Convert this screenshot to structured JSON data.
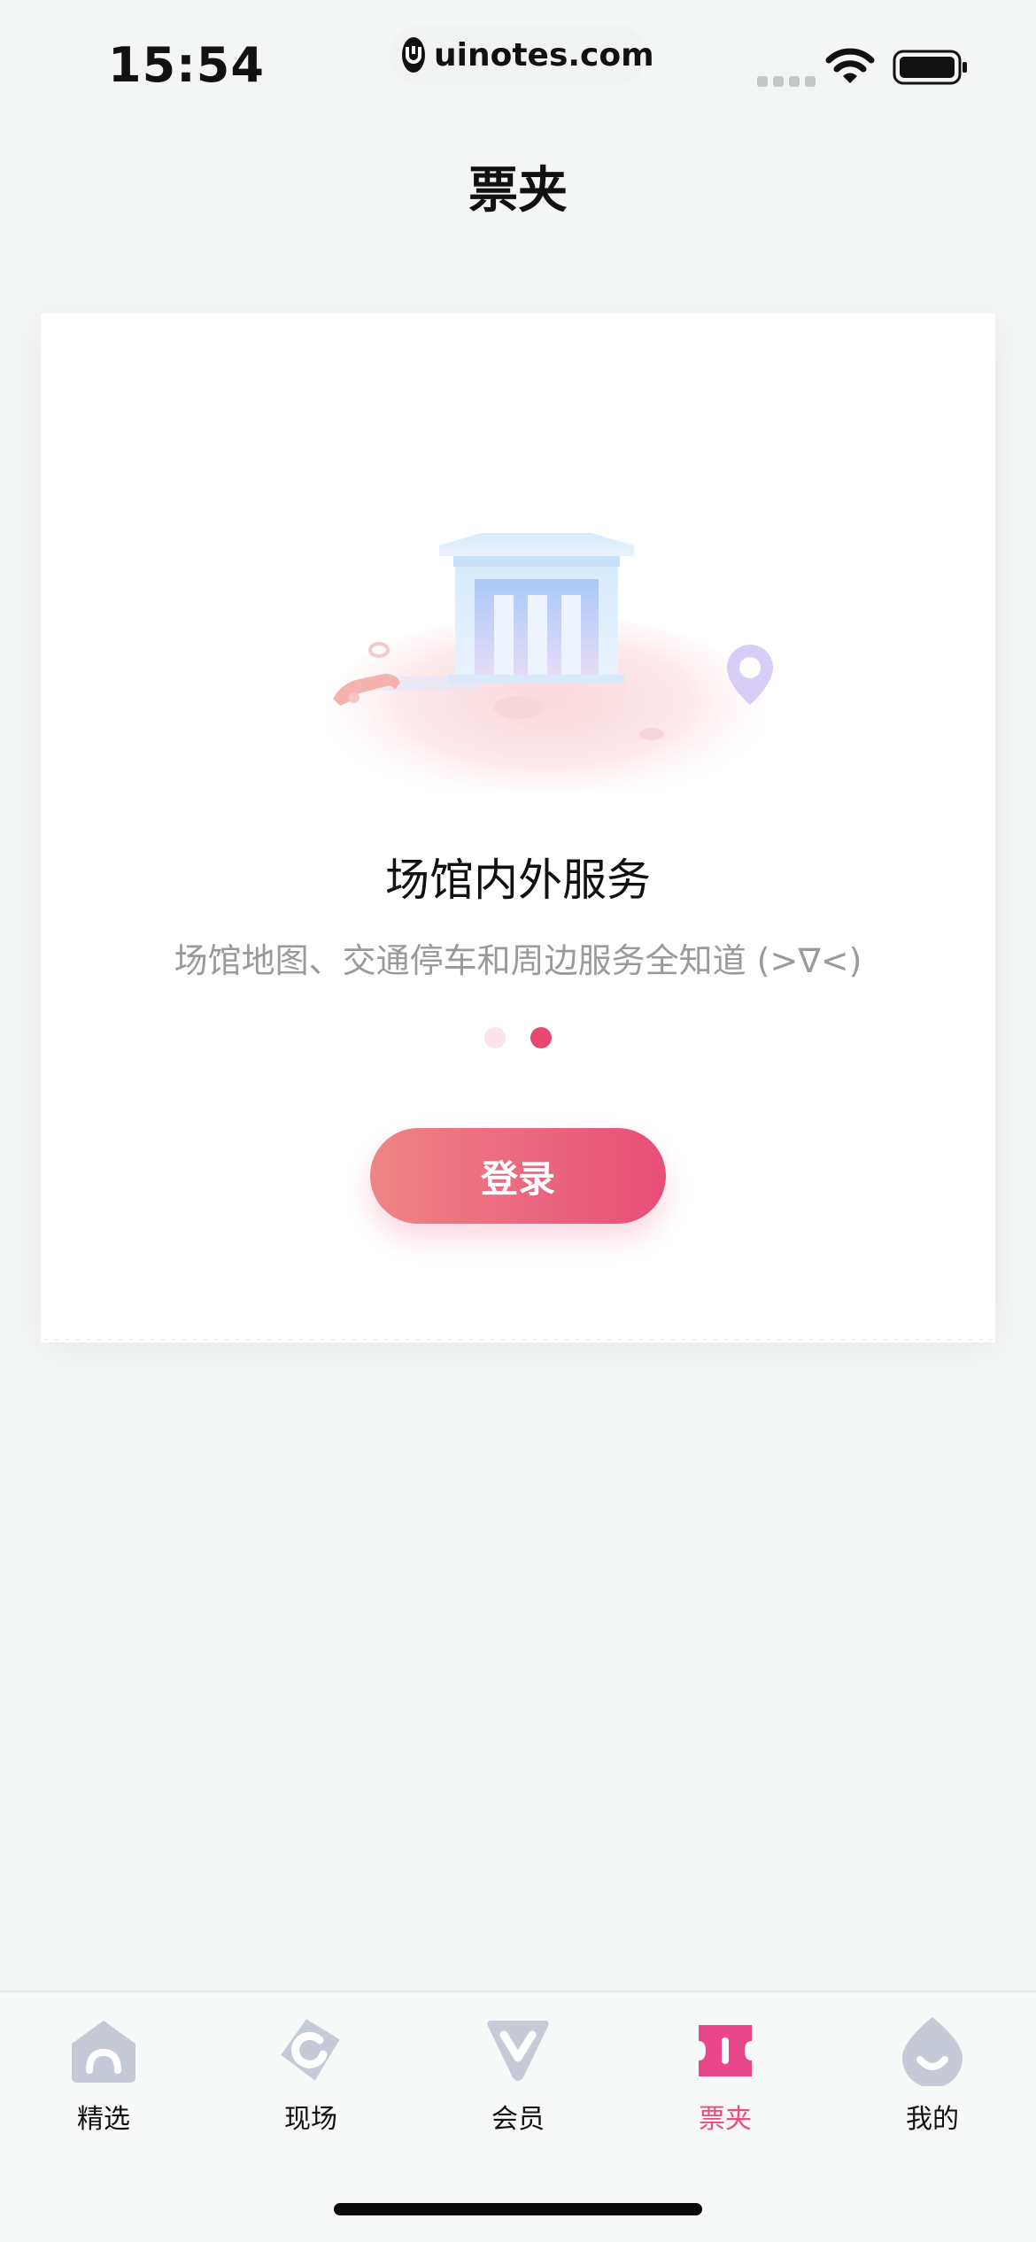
{
  "status_bar": {
    "time": "15:54",
    "url": "uinotes.com"
  },
  "nav": {
    "title": "票夹"
  },
  "card": {
    "illustration_icon": "venue-building-illustration",
    "feature_title": "场馆内外服务",
    "feature_desc": "场馆地图、交通停车和周边服务全知道 (>∇<)",
    "pager": {
      "count": 2,
      "active_index": 1
    },
    "login_label": "登录"
  },
  "tab_bar": {
    "items": [
      {
        "label": "精选",
        "icon": "home-icon",
        "active": false
      },
      {
        "label": "现场",
        "icon": "live-icon",
        "active": false
      },
      {
        "label": "会员",
        "icon": "member-icon",
        "active": false
      },
      {
        "label": "票夹",
        "icon": "ticket-icon",
        "active": true
      },
      {
        "label": "我的",
        "icon": "profile-icon",
        "active": false
      }
    ]
  },
  "colors": {
    "accent": "#e84e78",
    "inactive_icon": "#c5cad6",
    "background": "#f4f6f6"
  }
}
